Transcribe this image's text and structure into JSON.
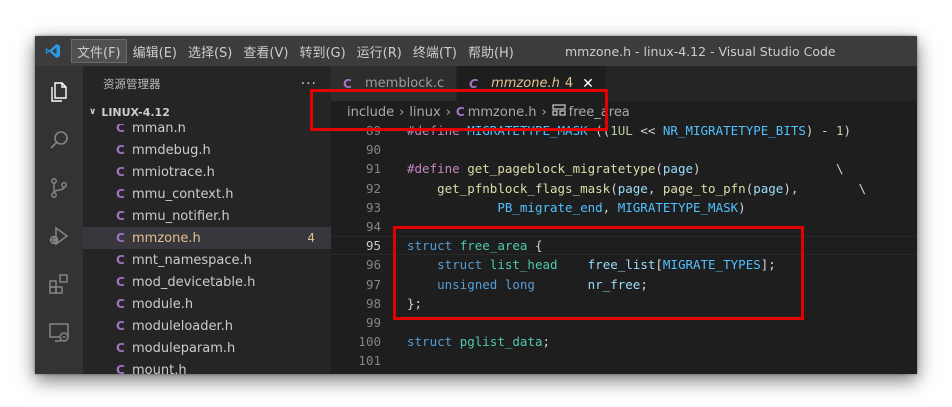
{
  "window": {
    "title": "mmzone.h - linux-4.12 - Visual Studio Code",
    "logo_icon": "vscode-logo-icon"
  },
  "menubar": {
    "items": [
      {
        "label": "文件(F)",
        "active": true
      },
      {
        "label": "编辑(E)"
      },
      {
        "label": "选择(S)"
      },
      {
        "label": "查看(V)"
      },
      {
        "label": "转到(G)"
      },
      {
        "label": "运行(R)"
      },
      {
        "label": "终端(T)"
      },
      {
        "label": "帮助(H)"
      }
    ]
  },
  "activitybar": {
    "icons": [
      "explorer-icon",
      "search-icon",
      "source-control-icon",
      "run-debug-icon",
      "extensions-icon",
      "remote-explorer-icon"
    ]
  },
  "sidebar": {
    "title": "资源管理器",
    "more": "···",
    "folder": "LINUX-4.12",
    "files": [
      {
        "name": "mman.h"
      },
      {
        "name": "mmdebug.h"
      },
      {
        "name": "mmiotrace.h"
      },
      {
        "name": "mmu_context.h"
      },
      {
        "name": "mmu_notifier.h"
      },
      {
        "name": "mmzone.h",
        "badge": "4",
        "selected": true
      },
      {
        "name": "mnt_namespace.h"
      },
      {
        "name": "mod_devicetable.h"
      },
      {
        "name": "module.h"
      },
      {
        "name": "moduleloader.h"
      },
      {
        "name": "moduleparam.h"
      },
      {
        "name": "mount.h"
      }
    ]
  },
  "file_icon_letter": "C",
  "tabs": [
    {
      "label": "memblock.c",
      "active": false
    },
    {
      "label": "mmzone.h",
      "active": true,
      "modified": "4",
      "close": "✕"
    }
  ],
  "breadcrumbs": {
    "parts": [
      "include",
      "linux",
      "mmzone.h",
      "free_area"
    ],
    "separator": "›",
    "symbol_icon": "struct-icon"
  },
  "code": {
    "lines": [
      {
        "num": "89",
        "tokens": [
          [
            "macro",
            "#define"
          ],
          [
            "plain",
            " "
          ],
          [
            "const",
            "MIGRATETYPE_MASK"
          ],
          [
            "plain",
            " (("
          ],
          [
            "num",
            "1UL"
          ],
          [
            "plain",
            " << "
          ],
          [
            "const",
            "NR_MIGRATETYPE_BITS"
          ],
          [
            "plain",
            ") - "
          ],
          [
            "num",
            "1"
          ],
          [
            "plain",
            ")"
          ]
        ]
      },
      {
        "num": "90",
        "tokens": []
      },
      {
        "num": "91",
        "tokens": [
          [
            "macro",
            "#define"
          ],
          [
            "plain",
            " "
          ],
          [
            "fn",
            "get_pageblock_migratetype"
          ],
          [
            "plain",
            "("
          ],
          [
            "var",
            "page"
          ],
          [
            "plain",
            ")                  \\"
          ]
        ]
      },
      {
        "num": "92",
        "tokens": [
          [
            "plain",
            "    "
          ],
          [
            "fn",
            "get_pfnblock_flags_mask"
          ],
          [
            "plain",
            "("
          ],
          [
            "var",
            "page"
          ],
          [
            "plain",
            ", "
          ],
          [
            "fn",
            "page_to_pfn"
          ],
          [
            "plain",
            "("
          ],
          [
            "var",
            "page"
          ],
          [
            "plain",
            "),        \\"
          ]
        ]
      },
      {
        "num": "93",
        "tokens": [
          [
            "plain",
            "            "
          ],
          [
            "const",
            "PB_migrate_end"
          ],
          [
            "plain",
            ", "
          ],
          [
            "const",
            "MIGRATETYPE_MASK"
          ],
          [
            "plain",
            ")"
          ]
        ]
      },
      {
        "num": "94",
        "tokens": []
      },
      {
        "num": "95",
        "current": true,
        "tokens": [
          [
            "kw",
            "struct"
          ],
          [
            "plain",
            " "
          ],
          [
            "type",
            "free_area"
          ],
          [
            "plain",
            " {"
          ]
        ]
      },
      {
        "num": "96",
        "tokens": [
          [
            "plain",
            "    "
          ],
          [
            "kw",
            "struct"
          ],
          [
            "plain",
            " "
          ],
          [
            "type",
            "list_head"
          ],
          [
            "plain",
            "    "
          ],
          [
            "var",
            "free_list"
          ],
          [
            "plain",
            "["
          ],
          [
            "const",
            "MIGRATE_TYPES"
          ],
          [
            "plain",
            "];"
          ]
        ]
      },
      {
        "num": "97",
        "tokens": [
          [
            "plain",
            "    "
          ],
          [
            "kw",
            "unsigned"
          ],
          [
            "plain",
            " "
          ],
          [
            "kw",
            "long"
          ],
          [
            "plain",
            "       "
          ],
          [
            "var",
            "nr_free"
          ],
          [
            "plain",
            ";"
          ]
        ]
      },
      {
        "num": "98",
        "tokens": [
          [
            "plain",
            "};"
          ]
        ]
      },
      {
        "num": "99",
        "tokens": []
      },
      {
        "num": "100",
        "tokens": [
          [
            "kw",
            "struct"
          ],
          [
            "plain",
            " "
          ],
          [
            "type",
            "pglist_data"
          ],
          [
            "plain",
            ";"
          ]
        ]
      },
      {
        "num": "101",
        "tokens": []
      }
    ]
  },
  "colors": {
    "highlight": "#e30000",
    "c_icon": "#a074c4",
    "modified": "#e2c08d"
  }
}
